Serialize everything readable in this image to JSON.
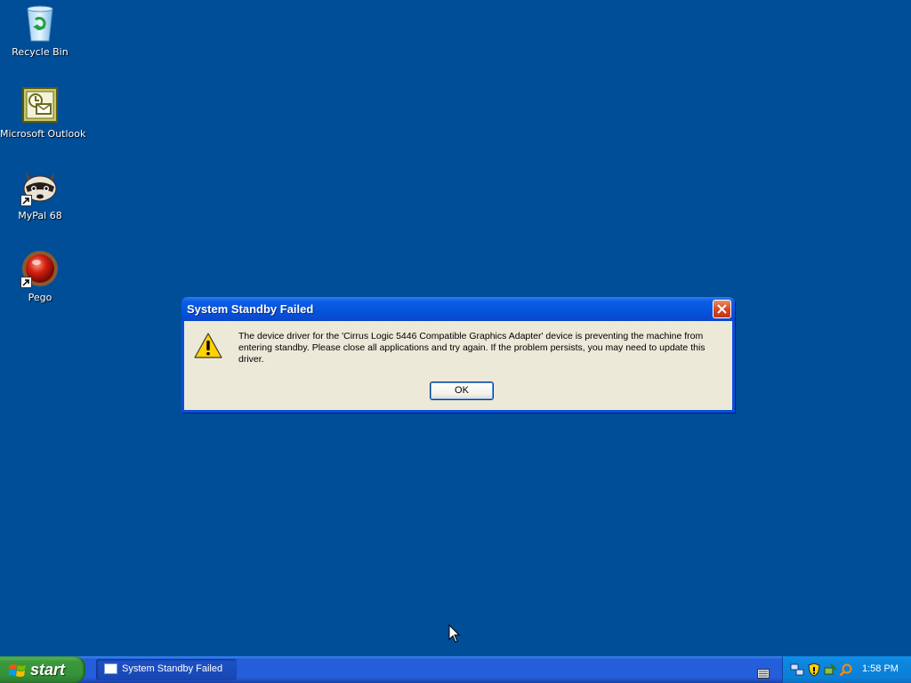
{
  "desktop": {
    "background_color": "#004e98",
    "icons": [
      {
        "label": "Recycle Bin",
        "icon": "recycle-bin-icon"
      },
      {
        "label": "Microsoft Outlook",
        "icon": "outlook-icon"
      },
      {
        "label": "MyPal 68",
        "icon": "mypal-icon"
      },
      {
        "label": "Pego",
        "icon": "pego-icon"
      }
    ]
  },
  "dialog": {
    "title": "System Standby Failed",
    "message": "The device driver for the 'Cirrus Logic 5446 Compatible Graphics Adapter' device is preventing the machine from entering standby. Please close all applications and try again. If the problem persists, you may need to update this driver.",
    "ok_label": "OK",
    "icon": "warning-icon"
  },
  "taskbar": {
    "start_label": "start",
    "tasks": [
      {
        "label": "System Standby Failed"
      }
    ],
    "clock": "1:58 PM",
    "tray_icons": [
      "network-icon",
      "security-shield-icon",
      "safely-remove-hardware-icon",
      "search-magnifier-icon"
    ]
  }
}
